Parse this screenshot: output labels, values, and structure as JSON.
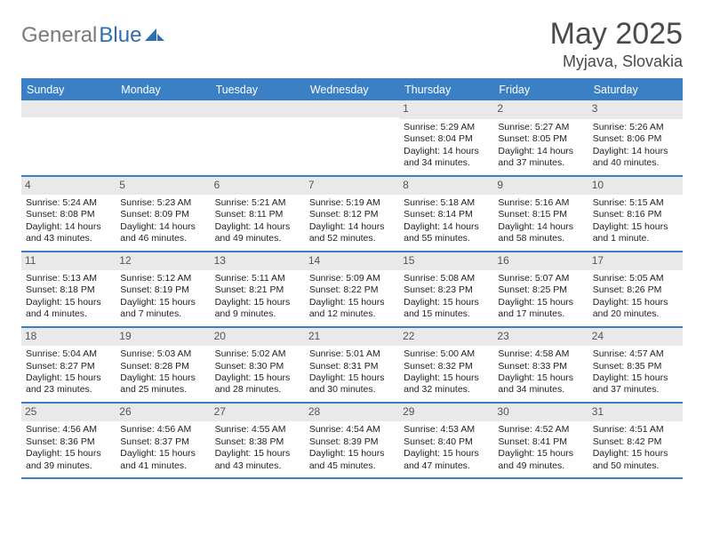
{
  "logo": {
    "part1": "General",
    "part2": "Blue"
  },
  "title": "May 2025",
  "location": "Myjava, Slovakia",
  "daysOfWeek": [
    "Sunday",
    "Monday",
    "Tuesday",
    "Wednesday",
    "Thursday",
    "Friday",
    "Saturday"
  ],
  "weeks": [
    [
      {
        "num": "",
        "lines": []
      },
      {
        "num": "",
        "lines": []
      },
      {
        "num": "",
        "lines": []
      },
      {
        "num": "",
        "lines": []
      },
      {
        "num": "1",
        "lines": [
          "Sunrise: 5:29 AM",
          "Sunset: 8:04 PM",
          "Daylight: 14 hours and 34 minutes."
        ]
      },
      {
        "num": "2",
        "lines": [
          "Sunrise: 5:27 AM",
          "Sunset: 8:05 PM",
          "Daylight: 14 hours and 37 minutes."
        ]
      },
      {
        "num": "3",
        "lines": [
          "Sunrise: 5:26 AM",
          "Sunset: 8:06 PM",
          "Daylight: 14 hours and 40 minutes."
        ]
      }
    ],
    [
      {
        "num": "4",
        "lines": [
          "Sunrise: 5:24 AM",
          "Sunset: 8:08 PM",
          "Daylight: 14 hours and 43 minutes."
        ]
      },
      {
        "num": "5",
        "lines": [
          "Sunrise: 5:23 AM",
          "Sunset: 8:09 PM",
          "Daylight: 14 hours and 46 minutes."
        ]
      },
      {
        "num": "6",
        "lines": [
          "Sunrise: 5:21 AM",
          "Sunset: 8:11 PM",
          "Daylight: 14 hours and 49 minutes."
        ]
      },
      {
        "num": "7",
        "lines": [
          "Sunrise: 5:19 AM",
          "Sunset: 8:12 PM",
          "Daylight: 14 hours and 52 minutes."
        ]
      },
      {
        "num": "8",
        "lines": [
          "Sunrise: 5:18 AM",
          "Sunset: 8:14 PM",
          "Daylight: 14 hours and 55 minutes."
        ]
      },
      {
        "num": "9",
        "lines": [
          "Sunrise: 5:16 AM",
          "Sunset: 8:15 PM",
          "Daylight: 14 hours and 58 minutes."
        ]
      },
      {
        "num": "10",
        "lines": [
          "Sunrise: 5:15 AM",
          "Sunset: 8:16 PM",
          "Daylight: 15 hours and 1 minute."
        ]
      }
    ],
    [
      {
        "num": "11",
        "lines": [
          "Sunrise: 5:13 AM",
          "Sunset: 8:18 PM",
          "Daylight: 15 hours and 4 minutes."
        ]
      },
      {
        "num": "12",
        "lines": [
          "Sunrise: 5:12 AM",
          "Sunset: 8:19 PM",
          "Daylight: 15 hours and 7 minutes."
        ]
      },
      {
        "num": "13",
        "lines": [
          "Sunrise: 5:11 AM",
          "Sunset: 8:21 PM",
          "Daylight: 15 hours and 9 minutes."
        ]
      },
      {
        "num": "14",
        "lines": [
          "Sunrise: 5:09 AM",
          "Sunset: 8:22 PM",
          "Daylight: 15 hours and 12 minutes."
        ]
      },
      {
        "num": "15",
        "lines": [
          "Sunrise: 5:08 AM",
          "Sunset: 8:23 PM",
          "Daylight: 15 hours and 15 minutes."
        ]
      },
      {
        "num": "16",
        "lines": [
          "Sunrise: 5:07 AM",
          "Sunset: 8:25 PM",
          "Daylight: 15 hours and 17 minutes."
        ]
      },
      {
        "num": "17",
        "lines": [
          "Sunrise: 5:05 AM",
          "Sunset: 8:26 PM",
          "Daylight: 15 hours and 20 minutes."
        ]
      }
    ],
    [
      {
        "num": "18",
        "lines": [
          "Sunrise: 5:04 AM",
          "Sunset: 8:27 PM",
          "Daylight: 15 hours and 23 minutes."
        ]
      },
      {
        "num": "19",
        "lines": [
          "Sunrise: 5:03 AM",
          "Sunset: 8:28 PM",
          "Daylight: 15 hours and 25 minutes."
        ]
      },
      {
        "num": "20",
        "lines": [
          "Sunrise: 5:02 AM",
          "Sunset: 8:30 PM",
          "Daylight: 15 hours and 28 minutes."
        ]
      },
      {
        "num": "21",
        "lines": [
          "Sunrise: 5:01 AM",
          "Sunset: 8:31 PM",
          "Daylight: 15 hours and 30 minutes."
        ]
      },
      {
        "num": "22",
        "lines": [
          "Sunrise: 5:00 AM",
          "Sunset: 8:32 PM",
          "Daylight: 15 hours and 32 minutes."
        ]
      },
      {
        "num": "23",
        "lines": [
          "Sunrise: 4:58 AM",
          "Sunset: 8:33 PM",
          "Daylight: 15 hours and 34 minutes."
        ]
      },
      {
        "num": "24",
        "lines": [
          "Sunrise: 4:57 AM",
          "Sunset: 8:35 PM",
          "Daylight: 15 hours and 37 minutes."
        ]
      }
    ],
    [
      {
        "num": "25",
        "lines": [
          "Sunrise: 4:56 AM",
          "Sunset: 8:36 PM",
          "Daylight: 15 hours and 39 minutes."
        ]
      },
      {
        "num": "26",
        "lines": [
          "Sunrise: 4:56 AM",
          "Sunset: 8:37 PM",
          "Daylight: 15 hours and 41 minutes."
        ]
      },
      {
        "num": "27",
        "lines": [
          "Sunrise: 4:55 AM",
          "Sunset: 8:38 PM",
          "Daylight: 15 hours and 43 minutes."
        ]
      },
      {
        "num": "28",
        "lines": [
          "Sunrise: 4:54 AM",
          "Sunset: 8:39 PM",
          "Daylight: 15 hours and 45 minutes."
        ]
      },
      {
        "num": "29",
        "lines": [
          "Sunrise: 4:53 AM",
          "Sunset: 8:40 PM",
          "Daylight: 15 hours and 47 minutes."
        ]
      },
      {
        "num": "30",
        "lines": [
          "Sunrise: 4:52 AM",
          "Sunset: 8:41 PM",
          "Daylight: 15 hours and 49 minutes."
        ]
      },
      {
        "num": "31",
        "lines": [
          "Sunrise: 4:51 AM",
          "Sunset: 8:42 PM",
          "Daylight: 15 hours and 50 minutes."
        ]
      }
    ]
  ]
}
